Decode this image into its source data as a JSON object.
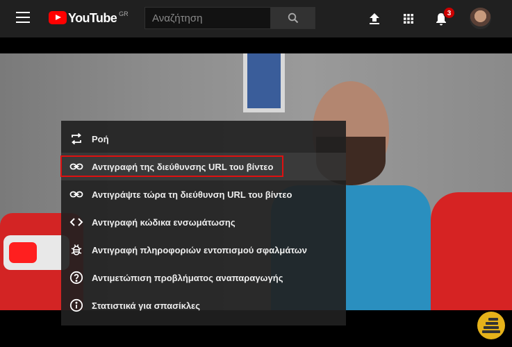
{
  "header": {
    "logo_text": "YouTube",
    "region": "GR",
    "search_placeholder": "Αναζήτηση",
    "notifications_count": "3"
  },
  "menu": {
    "items": [
      {
        "icon": "loop-icon",
        "label": "Ροή"
      },
      {
        "icon": "link-icon",
        "label": "Αντιγραφή της διεύθυνσης URL του βίντεο",
        "highlighted": true
      },
      {
        "icon": "link-icon",
        "label": "Αντιγράψτε τώρα τη διεύθυνση URL του βίντεο"
      },
      {
        "icon": "code-icon",
        "label": "Αντιγραφή κώδικα ενσωμάτωσης"
      },
      {
        "icon": "bug-icon",
        "label": "Αντιγραφή πληροφοριών εντοπισμού σφαλμάτων"
      },
      {
        "icon": "help-icon",
        "label": "Αντιμετώπιση προβλήματος αναπαραγωγής"
      },
      {
        "icon": "info-icon",
        "label": "Στατιστικά για σπασίκλες"
      }
    ]
  },
  "colors": {
    "topbar": "#202020",
    "brand_red": "#ff0000",
    "highlight_border": "#e01010",
    "menu_bg": "#212121"
  }
}
